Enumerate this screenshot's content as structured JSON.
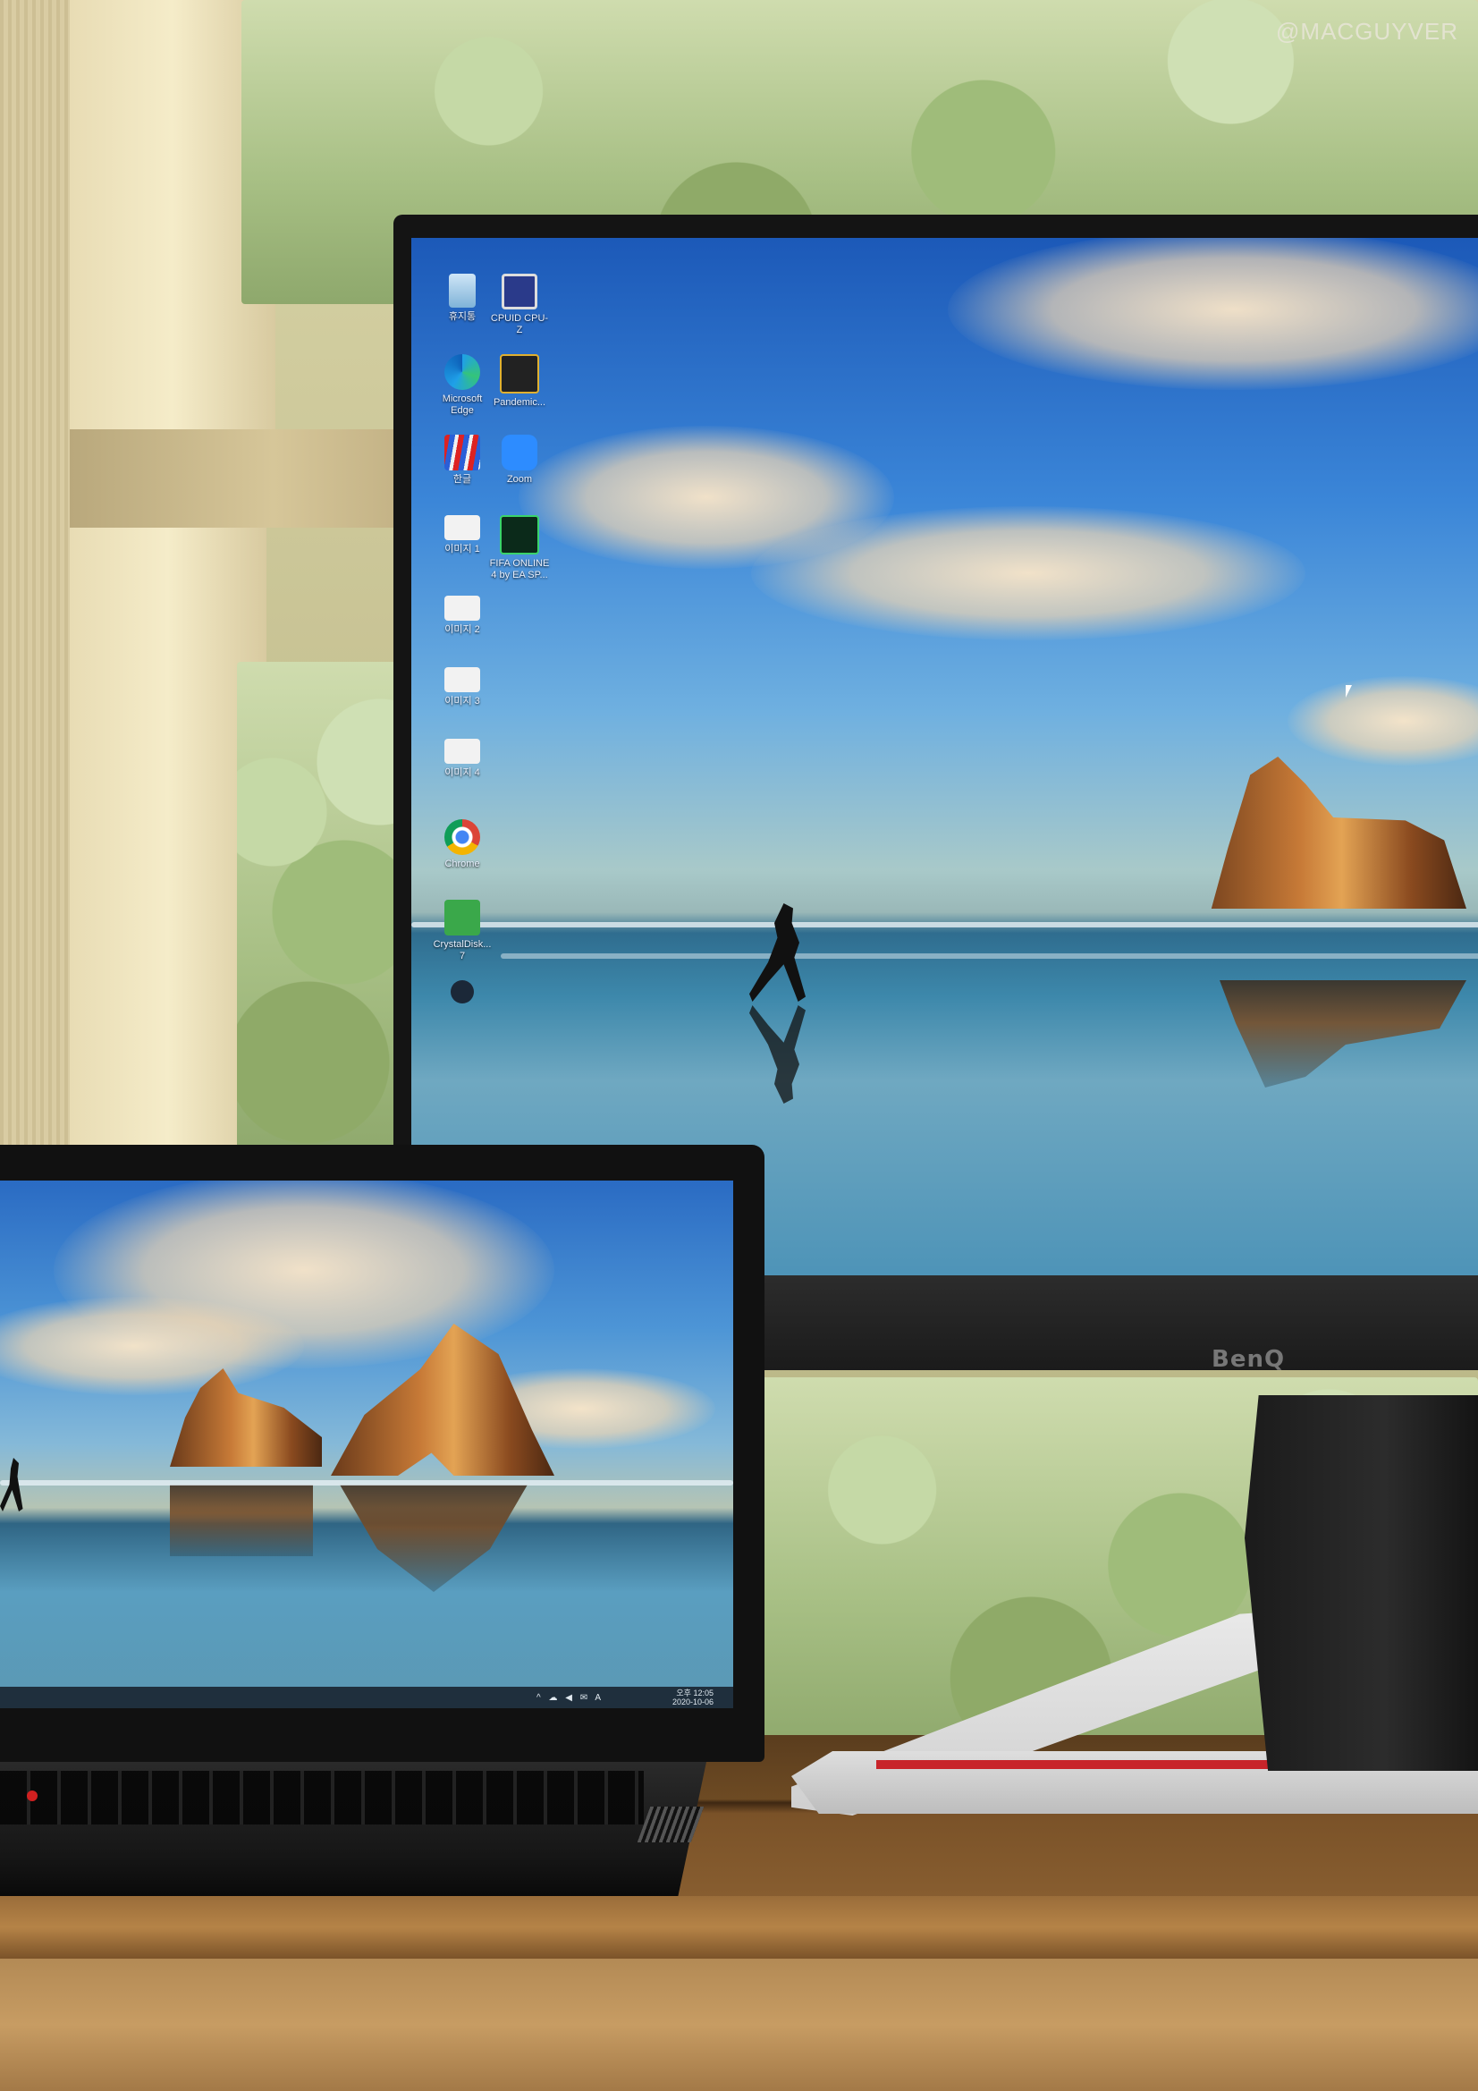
{
  "watermark": "@MACGUYVER",
  "monitor": {
    "brand": "BenQ",
    "desktop_icons": [
      {
        "name": "recycle-bin-icon",
        "label": "휴지통"
      },
      {
        "name": "cpuid-icon",
        "label": "CPUID CPU-Z"
      },
      {
        "name": "edge-icon",
        "label": "Microsoft Edge"
      },
      {
        "name": "pandemic-icon",
        "label": "Pandemic..."
      },
      {
        "name": "hangul-icon",
        "label": "한글"
      },
      {
        "name": "zoom-icon",
        "label": "Zoom"
      },
      {
        "name": "image1-icon",
        "label": "이미지 1"
      },
      {
        "name": "fifa-icon",
        "label": "FIFA ONLINE 4 by EA SP..."
      },
      {
        "name": "image2-icon",
        "label": "이미지 2"
      },
      {
        "name": "image3-icon",
        "label": "이미지 3"
      },
      {
        "name": "image4-icon",
        "label": "이미지 4"
      },
      {
        "name": "chrome-icon",
        "label": "Chrome"
      },
      {
        "name": "crystaldisk-icon",
        "label": "CrystalDisk... 7"
      },
      {
        "name": "steam-icon",
        "label": ""
      }
    ]
  },
  "laptop": {
    "taskbar": {
      "tray": "^ ☁ ◀ ✉ A",
      "time": "오후 12:05",
      "date": "2020-10-06"
    }
  },
  "colors": {
    "monitor_accent": "#c8242a",
    "trackpoint": "#d02020"
  }
}
